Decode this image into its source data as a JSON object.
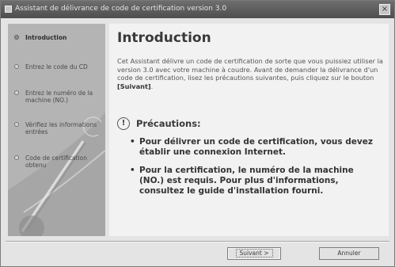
{
  "window": {
    "title": "Assistant de délivrance de code de certification version 3.0",
    "close_symbol": "×"
  },
  "sidebar": {
    "steps": [
      {
        "label": "Introduction",
        "current": true
      },
      {
        "label": "Entrez le code du CD",
        "current": false
      },
      {
        "label": "Entrez le numéro de la machine (NO.)",
        "current": false
      },
      {
        "label": "Vérifiez les informations entrées",
        "current": false
      },
      {
        "label": "Code de certification obtenu",
        "current": false
      }
    ]
  },
  "main": {
    "heading": "Introduction",
    "intro_text": "Cet Assistant délivre un code de certification de sorte que vous puissiez utiliser la version 3.0 avec votre machine à coudre. Avant de demander la délivrance d'un code de certification, lisez les précautions suivantes, puis cliquez sur le bouton",
    "intro_button_ref": "[Suivant]",
    "intro_end": ".",
    "precautions": {
      "title": "Précautions:",
      "items": [
        "Pour délivrer un code de certification, vous devez établir une connexion Internet.",
        "Pour la certification, le numéro de la machine (NO.) est requis. Pour plus d'informations, consultez le guide d'installation fourni."
      ]
    }
  },
  "footer": {
    "next_label": "Suivant >",
    "cancel_label": "Annuler"
  }
}
